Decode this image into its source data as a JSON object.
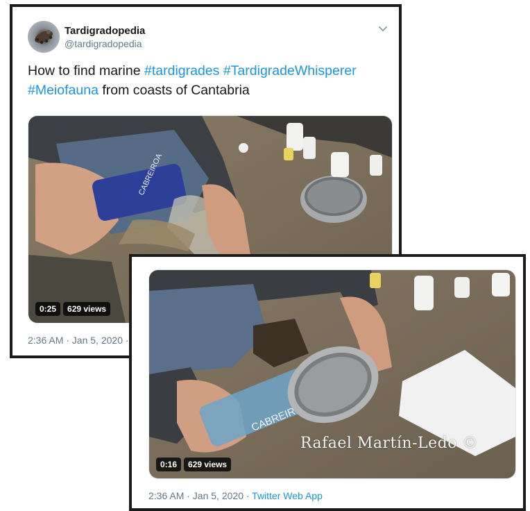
{
  "tweet1": {
    "author": {
      "name": "Tardigradopedia",
      "handle": "@tardigradopedia"
    },
    "text": {
      "prefix": "How to find marine ",
      "tag1": "#tardigrades",
      "space1": " ",
      "tag2": "#TardigradeWhisperer",
      "space2": " ",
      "tag3": "#Meiofauna",
      "suffix": " from coasts of Cantabria"
    },
    "video": {
      "duration": "0:25",
      "views": "629 views"
    },
    "timestamp": "2:36 AM · Jan 5, 2020 ·"
  },
  "tweet2": {
    "video": {
      "duration": "0:16",
      "views": "629 views",
      "watermark": "Rafael Martín-Ledo ©"
    },
    "timestamp": "2:36 AM · Jan 5, 2020 · ",
    "source": "Twitter Web App"
  },
  "colors": {
    "link": "#1b95e0",
    "secondary_text": "#657786",
    "border": "#1b1b1b"
  },
  "icons": {
    "more": "chevron-down-icon"
  }
}
